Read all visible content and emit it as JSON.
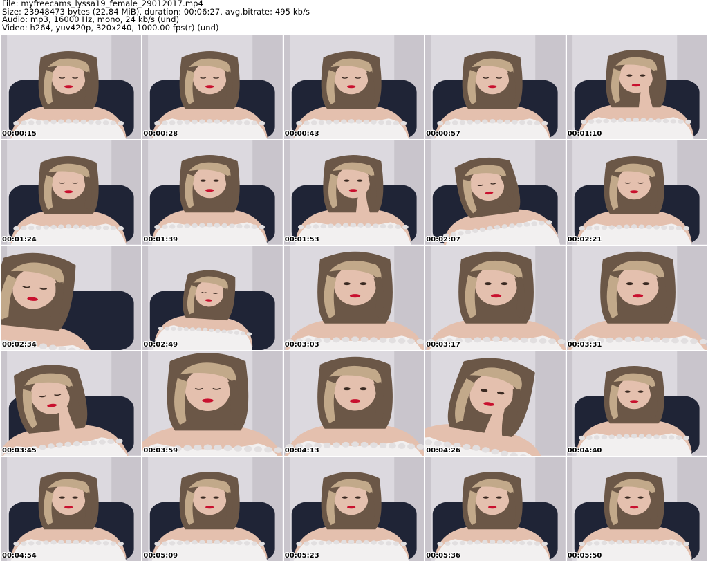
{
  "header": {
    "file": "File: myfreecams_lyssa19_female_29012017.mp4",
    "size": "Size: 23948473 bytes (22.84 MiB), duration: 00:06:27, avg.bitrate: 495 kb/s",
    "audio": "Audio: mp3, 16000 Hz, mono, 24 kb/s (und)",
    "video": "Video: h264, yuv420p, 320x240, 1000.00 fps(r) (und)"
  },
  "colors": {
    "wall": "#dcd9df",
    "wall_shadow": "#c9c5cc",
    "chair": "#1f2436",
    "hair": "#6b5747",
    "hair_light": "#c2a98a",
    "skin": "#e4c0ae",
    "top": "#f2f0f0",
    "lips": "#c8102e"
  },
  "thumbnails": [
    {
      "time": "00:00:15",
      "pose": "down"
    },
    {
      "time": "00:00:28",
      "pose": "down"
    },
    {
      "time": "00:00:43",
      "pose": "down"
    },
    {
      "time": "00:00:57",
      "pose": "down"
    },
    {
      "time": "00:01:10",
      "pose": "eating"
    },
    {
      "time": "00:01:24",
      "pose": "down"
    },
    {
      "time": "00:01:39",
      "pose": "front"
    },
    {
      "time": "00:01:53",
      "pose": "eating"
    },
    {
      "time": "00:02:07",
      "pose": "tilt"
    },
    {
      "time": "00:02:21",
      "pose": "down"
    },
    {
      "time": "00:02:34",
      "pose": "close-left"
    },
    {
      "time": "00:02:49",
      "pose": "small"
    },
    {
      "time": "00:03:03",
      "pose": "close"
    },
    {
      "time": "00:03:17",
      "pose": "close"
    },
    {
      "time": "00:03:31",
      "pose": "close"
    },
    {
      "time": "00:03:45",
      "pose": "hand-hair"
    },
    {
      "time": "00:03:59",
      "pose": "close-down"
    },
    {
      "time": "00:04:13",
      "pose": "close"
    },
    {
      "time": "00:04:26",
      "pose": "phone"
    },
    {
      "time": "00:04:40",
      "pose": "front"
    },
    {
      "time": "00:04:54",
      "pose": "front"
    },
    {
      "time": "00:05:09",
      "pose": "front"
    },
    {
      "time": "00:05:23",
      "pose": "front"
    },
    {
      "time": "00:05:36",
      "pose": "front"
    },
    {
      "time": "00:05:50",
      "pose": "front"
    }
  ]
}
